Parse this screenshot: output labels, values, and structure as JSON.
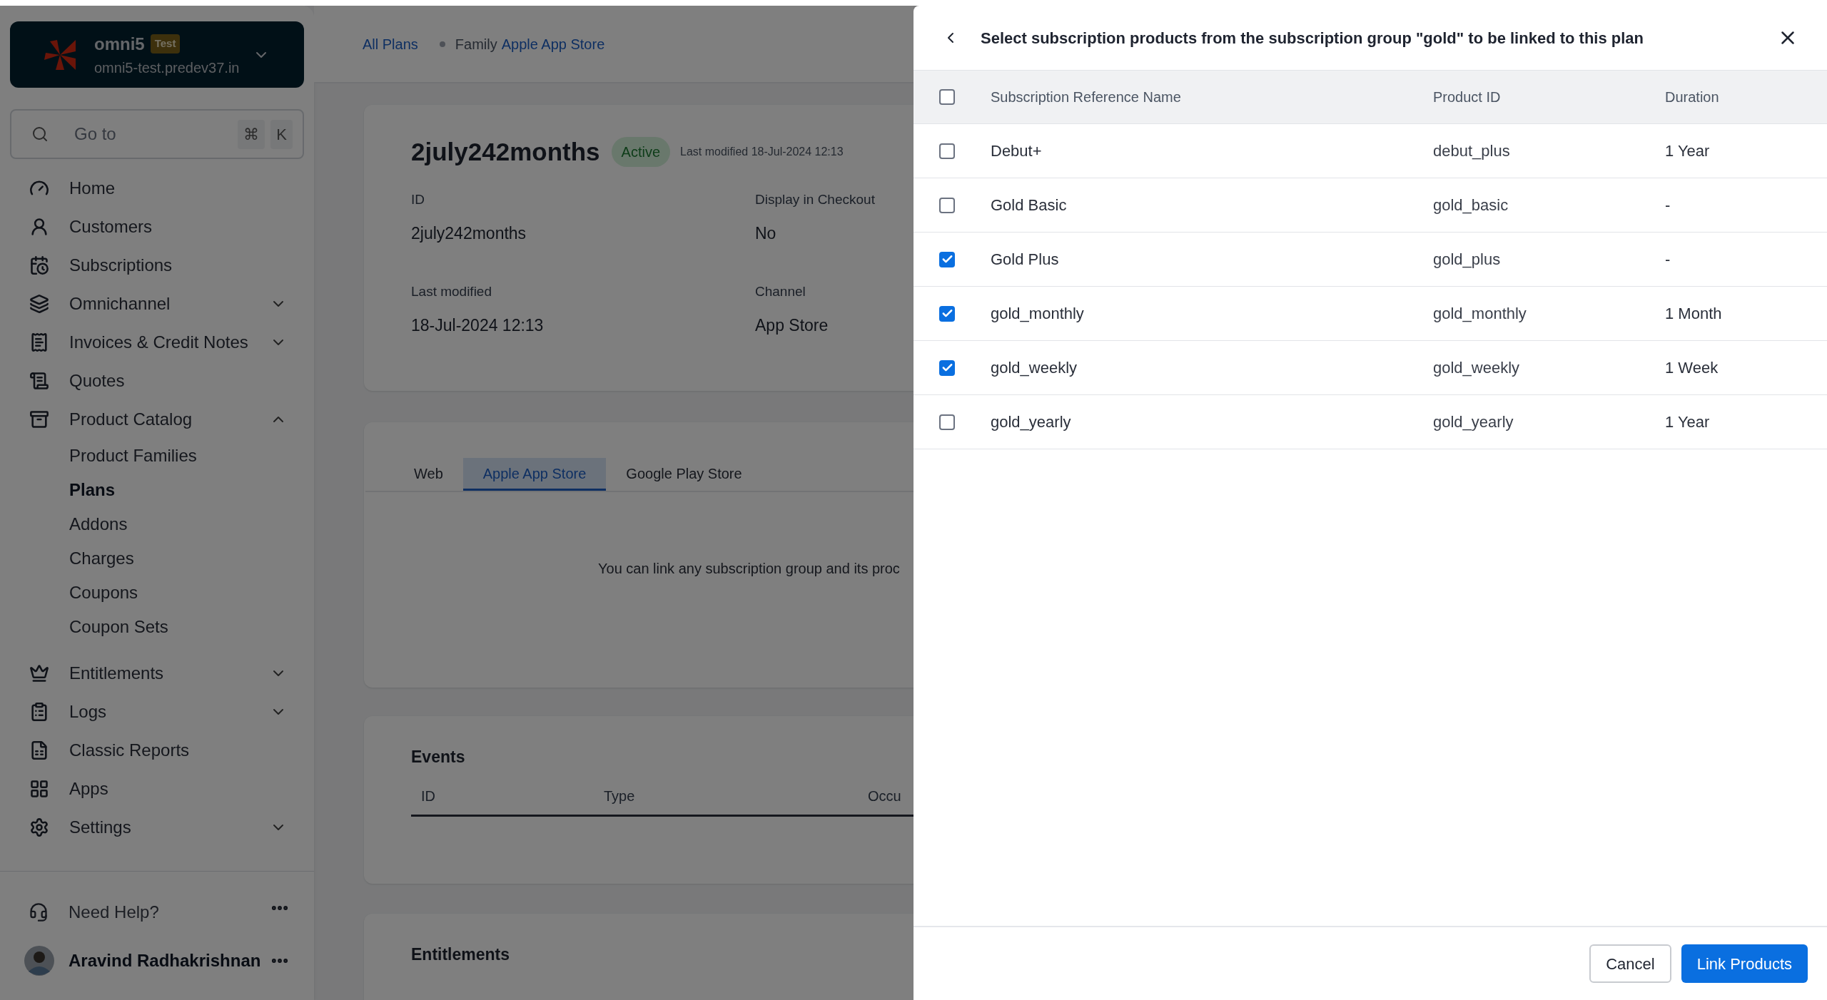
{
  "org": {
    "name": "omni5",
    "badge": "Test",
    "domain": "omni5-test.predev37.in"
  },
  "search": {
    "placeholder": "Go to",
    "keys": [
      "⌘",
      "K"
    ]
  },
  "nav": [
    {
      "label": "Home",
      "selected": false
    },
    {
      "label": "Customers",
      "selected": false
    },
    {
      "label": "Subscriptions",
      "selected": false
    },
    {
      "label": "Omnichannel",
      "selected": false,
      "expanded": false
    },
    {
      "label": "Invoices & Credit Notes",
      "selected": false,
      "expanded": false
    },
    {
      "label": "Quotes",
      "selected": false
    },
    {
      "label": "Product Catalog",
      "selected": false,
      "expanded": true,
      "children": [
        {
          "label": "Product Families",
          "selected": false
        },
        {
          "label": "Plans",
          "selected": true
        },
        {
          "label": "Addons",
          "selected": false
        },
        {
          "label": "Charges",
          "selected": false
        },
        {
          "label": "Coupons",
          "selected": false
        },
        {
          "label": "Coupon Sets",
          "selected": false
        }
      ]
    },
    {
      "label": "Entitlements",
      "selected": false,
      "expanded": false
    },
    {
      "label": "Logs",
      "selected": false,
      "expanded": false
    },
    {
      "label": "Classic Reports",
      "selected": false
    },
    {
      "label": "Apps",
      "selected": false
    },
    {
      "label": "Settings",
      "selected": false,
      "expanded": false
    }
  ],
  "help": {
    "label": "Need Help?"
  },
  "user": {
    "name": "Aravind Radhakrishnan"
  },
  "breadcrumb": {
    "root": "All Plans",
    "prefix": "Family",
    "family": "Apple App Store"
  },
  "plan": {
    "title": "2july242months",
    "status": "Active",
    "last_modified": "Last modified 18-Jul-2024 12:13",
    "fields": [
      {
        "label": "ID",
        "value": "2july242months"
      },
      {
        "label": "Display in Checkout",
        "value": "No"
      },
      {
        "label": "Last modified",
        "value": "18-Jul-2024 12:13"
      },
      {
        "label": "Channel",
        "value": "App Store"
      }
    ]
  },
  "channel_tabs": [
    {
      "label": "Web",
      "selected": false
    },
    {
      "label": "Apple App Store",
      "selected": true
    },
    {
      "label": "Google Play Store",
      "selected": false
    }
  ],
  "channel_message": "You can link any subscription group and its proc",
  "events": {
    "title": "Events",
    "columns": [
      "ID",
      "Type",
      "Occu"
    ]
  },
  "entitlements": {
    "title": "Entitlements"
  },
  "modal": {
    "title": "Select subscription products from the subscription group \"gold\" to be linked to this plan",
    "select_all_checked": false,
    "columns": [
      "Subscription Reference Name",
      "Product ID",
      "Duration"
    ],
    "rows": [
      {
        "name": "Debut+",
        "product_id": "debut_plus",
        "duration": "1 Year",
        "checked": false
      },
      {
        "name": "Gold Basic",
        "product_id": "gold_basic",
        "duration": "-",
        "checked": false
      },
      {
        "name": "Gold Plus",
        "product_id": "gold_plus",
        "duration": "-",
        "checked": true
      },
      {
        "name": "gold_monthly",
        "product_id": "gold_monthly",
        "duration": "1 Month",
        "checked": true
      },
      {
        "name": "gold_weekly",
        "product_id": "gold_weekly",
        "duration": "1 Week",
        "checked": true
      },
      {
        "name": "gold_yearly",
        "product_id": "gold_yearly",
        "duration": "1 Year",
        "checked": false
      }
    ],
    "cancel": "Cancel",
    "confirm": "Link Products"
  }
}
